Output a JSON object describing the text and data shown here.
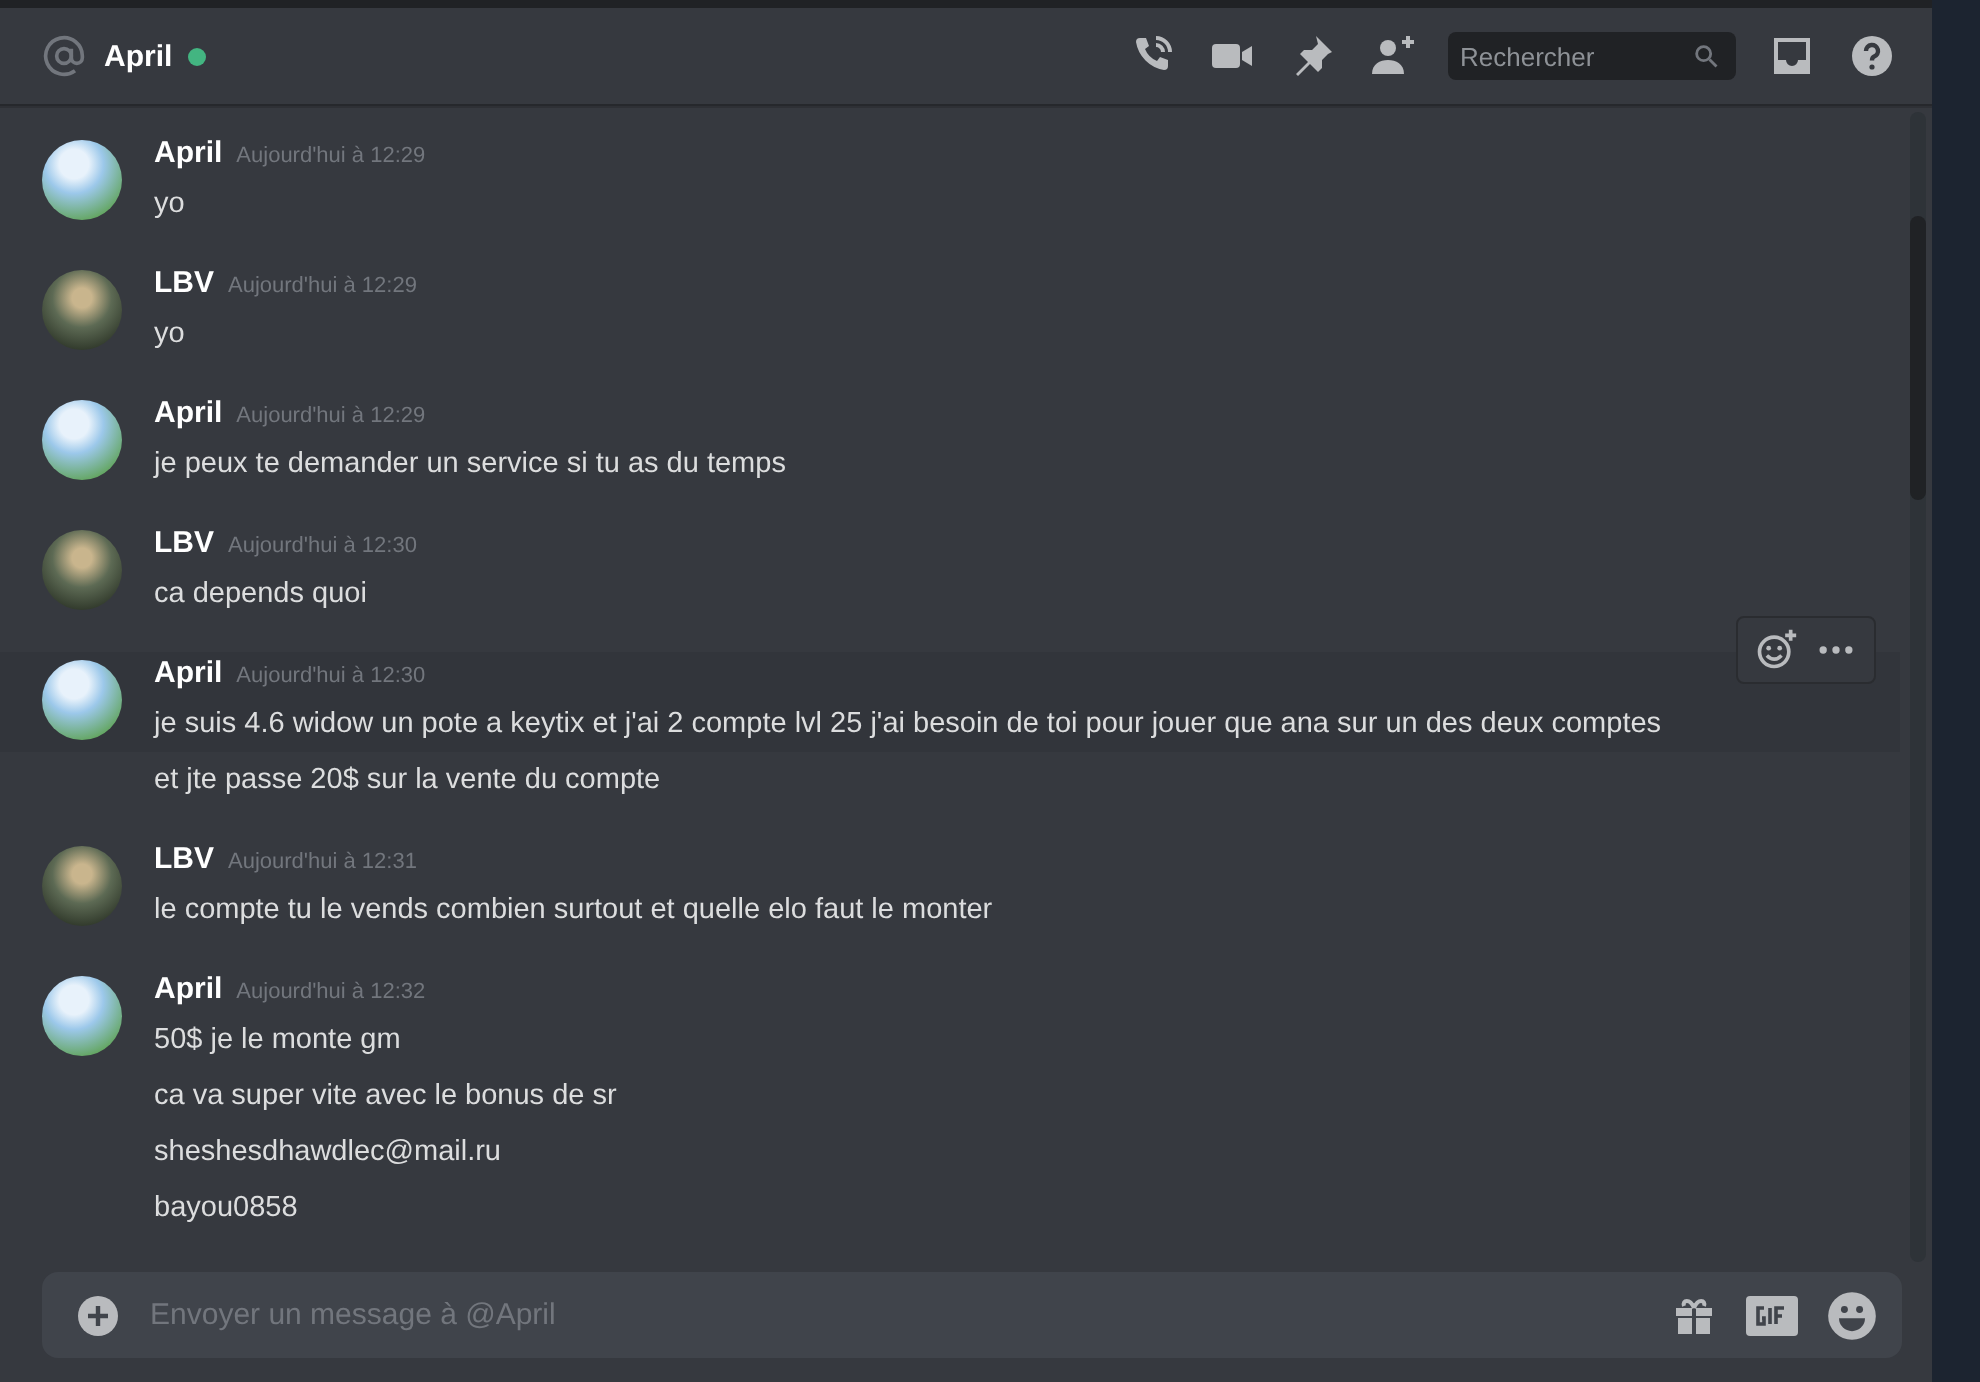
{
  "header": {
    "channel_name": "April",
    "online": true,
    "search": {
      "placeholder": "Rechercher"
    }
  },
  "messages": [
    {
      "author": "April",
      "avatar": {
        "kind": "sky"
      },
      "timestamp": "Aujourd'hui à 12:29",
      "lines": [
        {
          "text": "yo",
          "hovered": false
        }
      ]
    },
    {
      "author": "LBV",
      "avatar": {
        "kind": "dark"
      },
      "timestamp": "Aujourd'hui à 12:29",
      "lines": [
        {
          "text": "yo",
          "hovered": false
        }
      ]
    },
    {
      "author": "April",
      "avatar": {
        "kind": "sky"
      },
      "timestamp": "Aujourd'hui à 12:29",
      "lines": [
        {
          "text": "je peux te demander un service si tu as du temps",
          "hovered": false
        }
      ]
    },
    {
      "author": "LBV",
      "avatar": {
        "kind": "dark"
      },
      "timestamp": "Aujourd'hui à 12:30",
      "lines": [
        {
          "text": "ca depends quoi",
          "hovered": false
        }
      ]
    },
    {
      "author": "April",
      "avatar": {
        "kind": "sky"
      },
      "timestamp": "Aujourd'hui à 12:30",
      "lines": [
        {
          "text": "je suis 4.6 widow un pote a keytix et j'ai 2 compte lvl 25 j'ai besoin de toi pour jouer que ana sur un des deux comptes",
          "hovered": true
        },
        {
          "text": "et jte passe 20$ sur la vente du compte",
          "hovered": false
        }
      ]
    },
    {
      "author": "LBV",
      "avatar": {
        "kind": "dark"
      },
      "timestamp": "Aujourd'hui à 12:31",
      "lines": [
        {
          "text": "le compte tu le vends combien surtout et quelle elo faut le monter",
          "hovered": false
        }
      ]
    },
    {
      "author": "April",
      "avatar": {
        "kind": "sky"
      },
      "timestamp": "Aujourd'hui à 12:32",
      "lines": [
        {
          "text": "50$ je le monte gm",
          "hovered": false
        },
        {
          "text": "ca va super vite avec le bonus de sr",
          "hovered": false
        },
        {
          "text": "sheshesdhawdlec@mail.ru",
          "hovered": false
        },
        {
          "text": "bayou0858",
          "hovered": false
        }
      ]
    }
  ],
  "composer": {
    "placeholder": "Envoyer un message à @April"
  }
}
